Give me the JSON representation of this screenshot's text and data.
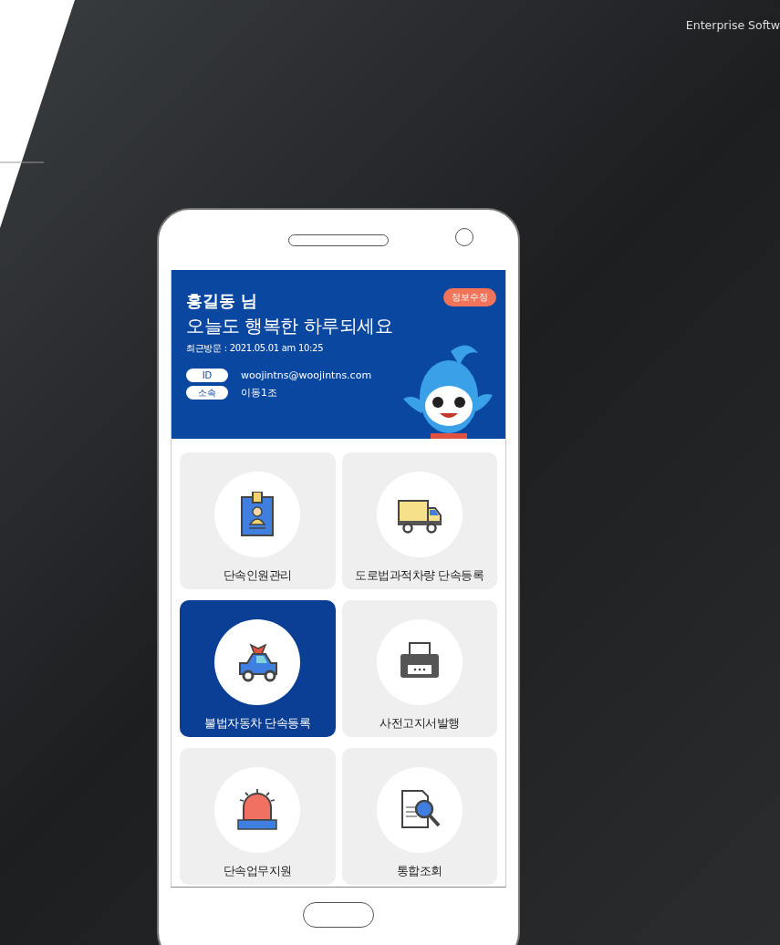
{
  "overlay_text": "Enterprise Softw",
  "header": {
    "user_name": "홍길동 님",
    "greeting": "오늘도 행복한 하루되세요",
    "last_visit": "최근방문 : 2021.05.01 am 10:25",
    "edit_button": "정보수정",
    "fields": [
      {
        "label": "ID",
        "value": "woojintns@woojintns.com"
      },
      {
        "label": "소속",
        "value": "이동1조"
      }
    ]
  },
  "menu": [
    {
      "kind": "id-card",
      "label": "단속인원관리",
      "selected": false
    },
    {
      "kind": "truck",
      "label": "도로법과적차량 단속등록",
      "selected": false
    },
    {
      "kind": "car",
      "label": "불법자동차 단속등록",
      "selected": true
    },
    {
      "kind": "printer",
      "label": "사전고지서발행",
      "selected": false
    },
    {
      "kind": "siren",
      "label": "단속업무지원",
      "selected": false
    },
    {
      "kind": "search-doc",
      "label": "통합조회",
      "selected": false
    }
  ]
}
